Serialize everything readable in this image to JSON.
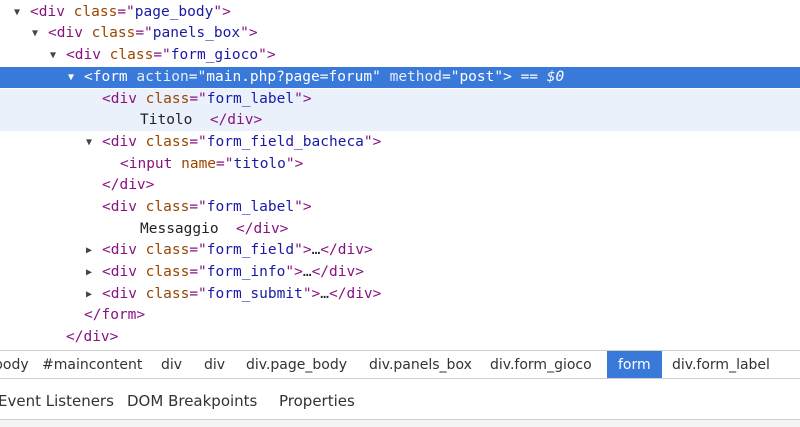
{
  "dom_tree": {
    "lines": [
      {
        "indent": 0,
        "toggle": "open",
        "tag": "div",
        "class": "page_body"
      },
      {
        "indent": 1,
        "toggle": "open",
        "tag": "div",
        "class": "panels_box"
      },
      {
        "indent": 2,
        "toggle": "open",
        "tag": "div",
        "class": "form_gioco"
      },
      {
        "indent": 3,
        "toggle": "open",
        "tag": "form",
        "action": "main.php?page=forum",
        "method": "post",
        "selected_marker": "== $0"
      },
      {
        "indent": 4,
        "tag": "div",
        "class": "form_label"
      },
      {
        "text": "Titolo  "
      },
      {
        "indent": 4,
        "toggle": "open",
        "tag": "div",
        "class": "form_field_bacheca"
      },
      {
        "indent": 5,
        "tag": "input",
        "name": "titolo"
      },
      {
        "indent": 4,
        "closing": "div"
      },
      {
        "indent": 4,
        "tag": "div",
        "class": "form_label"
      },
      {
        "text": "Messaggio  "
      },
      {
        "indent": 4,
        "toggle": "closed",
        "tag": "div",
        "class": "form_field",
        "ellipsis": "…"
      },
      {
        "indent": 4,
        "toggle": "closed",
        "tag": "div",
        "class": "form_info",
        "ellipsis": "…"
      },
      {
        "indent": 4,
        "toggle": "closed",
        "tag": "div",
        "class": "form_submit",
        "ellipsis": "…"
      },
      {
        "indent": 3,
        "closing": "form"
      },
      {
        "indent": 2,
        "closing": "div"
      }
    ]
  },
  "breadcrumbs": [
    {
      "label": "body"
    },
    {
      "label": "#maincontent"
    },
    {
      "label": "div"
    },
    {
      "label": "div"
    },
    {
      "label": "div.page_body"
    },
    {
      "label": "div.panels_box"
    },
    {
      "label": "div.form_gioco"
    },
    {
      "label": "form",
      "active": true
    },
    {
      "label": "div.form_label"
    }
  ],
  "sidebar_tabs": [
    {
      "label": "Event Listeners"
    },
    {
      "label": "DOM Breakpoints"
    },
    {
      "label": "Properties"
    }
  ],
  "colors": {
    "selection": "#3879d9",
    "tag": "#881280",
    "attr_name": "#994500",
    "attr_value": "#1a1aa6"
  }
}
